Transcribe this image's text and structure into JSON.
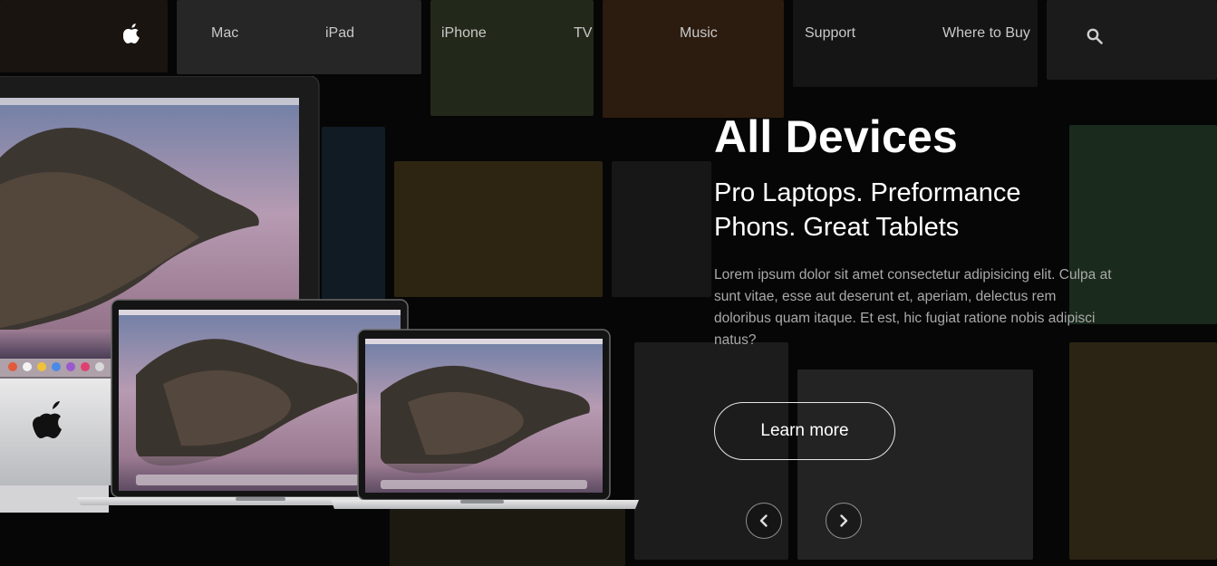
{
  "nav": {
    "logo_icon": "apple-logo-icon",
    "items": [
      {
        "label": "Mac"
      },
      {
        "label": "iPad"
      },
      {
        "label": "iPhone"
      },
      {
        "label": "TV"
      },
      {
        "label": "Music"
      },
      {
        "label": "Support"
      },
      {
        "label": "Where to Buy"
      }
    ],
    "search_icon": "search-icon"
  },
  "hero": {
    "title": "All Devices",
    "subtitle_line1": "Pro Laptops. Preformance",
    "subtitle_line2": "Phons. Great Tablets",
    "body": "Lorem ipsum dolor sit amet consectetur adipisicing elit. Culpa at sunt vitae, esse aut deserunt et, aperiam, delectus rem doloribus quam itaque. Et est, hic fugiat ratione nobis adipisci natus?",
    "button_label": "Learn more"
  },
  "carousel": {
    "prev_icon": "chevron-left-icon",
    "next_icon": "chevron-right-icon"
  },
  "colors": {
    "background": "#000000",
    "nav_text": "#c9c9c9",
    "body_text": "#a9a9a9",
    "accent": "#ffffff"
  }
}
